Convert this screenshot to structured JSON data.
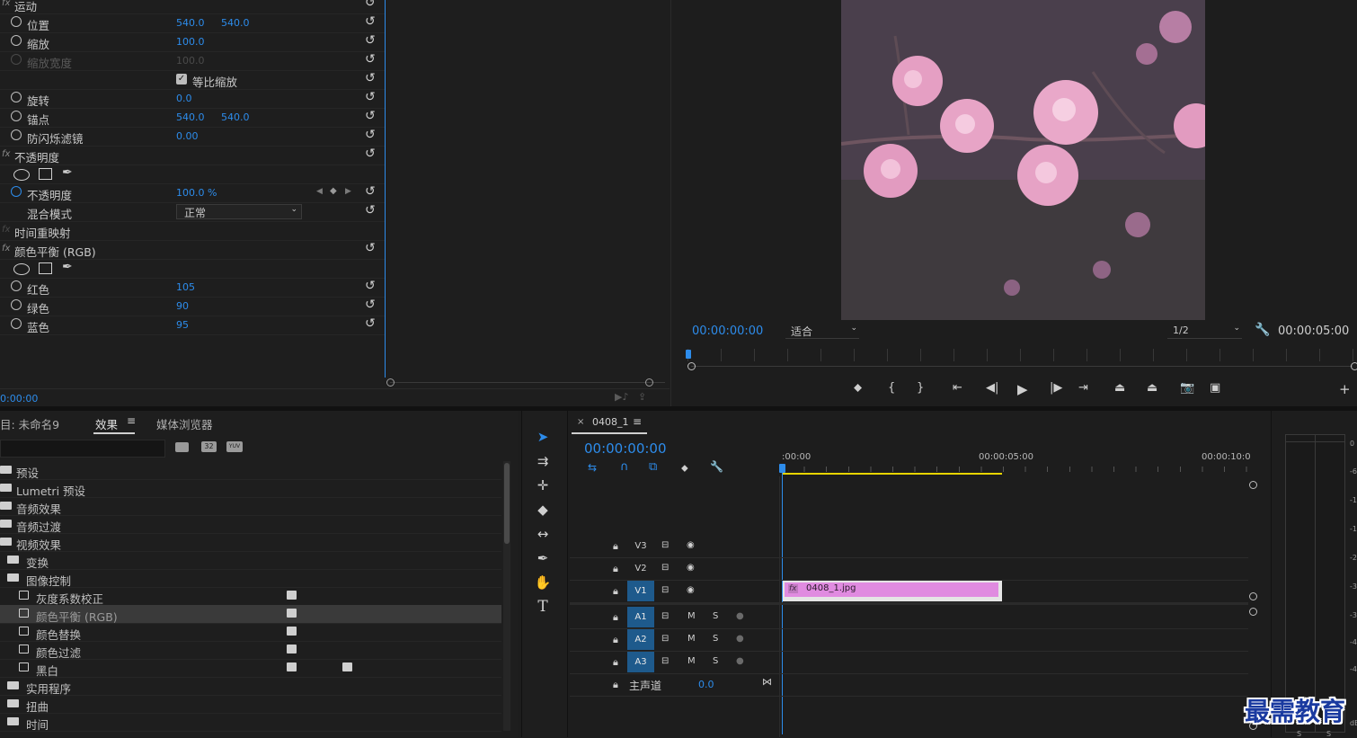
{
  "effect_controls": {
    "motion_group": "运动",
    "position_label": "位置",
    "position_x": "540.0",
    "position_y": "540.0",
    "scale_label": "缩放",
    "scale_value": "100.0",
    "scale_width_label": "缩放宽度",
    "scale_width_value": "100.0",
    "uniform_scale_label": "等比缩放",
    "rotation_label": "旋转",
    "rotation_value": "0.0",
    "anchor_label": "锚点",
    "anchor_x": "540.0",
    "anchor_y": "540.0",
    "antiflicker_label": "防闪烁滤镜",
    "antiflicker_value": "0.00",
    "opacity_group": "不透明度",
    "opacity_label": "不透明度",
    "opacity_value": "100.0 %",
    "blend_label": "混合模式",
    "blend_value": "正常",
    "time_remap_group": "时间重映射",
    "color_balance_group": "颜色平衡 (RGB)",
    "red_label": "红色",
    "red_value": "105",
    "green_label": "绿色",
    "green_value": "90",
    "blue_label": "蓝色",
    "blue_value": "95",
    "timecode": "0:00:00"
  },
  "program_monitor": {
    "current_time": "00:00:00:00",
    "fit_value": "适合",
    "resolution": "1/2",
    "duration": "00:00:05:00"
  },
  "project_panel": {
    "tab_project": "目: 未命名9",
    "tab_effects": "效果",
    "tab_media_browser": "媒体浏览器",
    "badge_32": "32",
    "badge_yuv": "YUV",
    "items": [
      {
        "label": "预设"
      },
      {
        "label": "Lumetri 预设"
      },
      {
        "label": "音频效果"
      },
      {
        "label": "音频过渡"
      },
      {
        "label": "视频效果"
      },
      {
        "label": "变换"
      },
      {
        "label": "图像控制"
      },
      {
        "label": "灰度系数校正"
      },
      {
        "label": "颜色平衡 (RGB)"
      },
      {
        "label": "颜色替换"
      },
      {
        "label": "颜色过滤"
      },
      {
        "label": "黑白"
      },
      {
        "label": "实用程序"
      },
      {
        "label": "扭曲"
      },
      {
        "label": "时间"
      }
    ]
  },
  "timeline": {
    "sequence_name": "0408_1",
    "timecode": "00:00:00:00",
    "ruler": [
      ":00:00",
      "00:00:05:00",
      "00:00:10:0"
    ],
    "tracks": {
      "v3": "V3",
      "v2": "V2",
      "v1": "V1",
      "a1": "A1",
      "a2": "A2",
      "a3": "A3"
    },
    "mute": "M",
    "solo": "S",
    "master_label": "主声道",
    "master_value": "0.0",
    "clip_name": "0408_1.jpg",
    "clip_fx": "fx"
  },
  "meters": {
    "ticks": [
      "0",
      "-6",
      "-1",
      "-1",
      "-2",
      "-3",
      "-3",
      "-4",
      "-4",
      "dB"
    ],
    "solo_labels": [
      "S",
      "S"
    ]
  },
  "watermark": "最需教育",
  "colors": {
    "accent": "#2d8ceb",
    "clip": "#e08be0",
    "playhead": "#2d8ceb",
    "work_area": "#e8d400",
    "panel_bg": "#1d1d1d"
  }
}
